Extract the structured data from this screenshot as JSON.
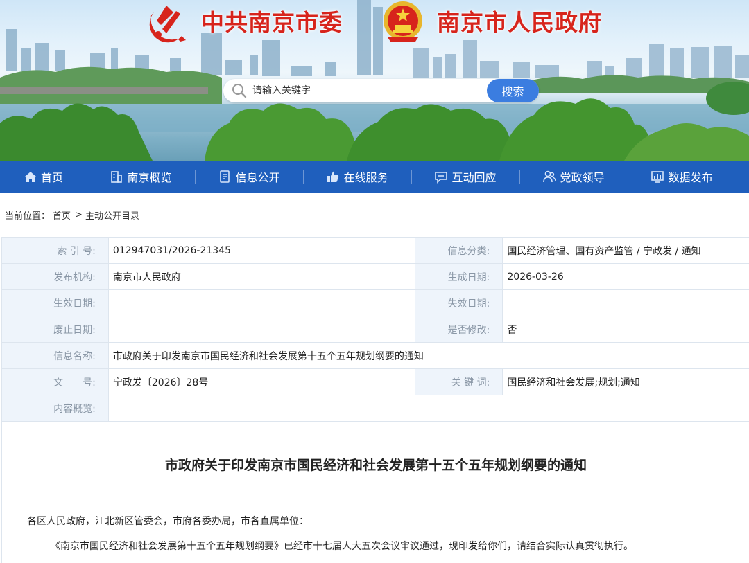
{
  "header": {
    "party_title": "中共南京市委",
    "gov_title": "南京市人民政府",
    "search": {
      "placeholder": "请输入关键字",
      "button": "搜索"
    }
  },
  "nav": {
    "items": [
      {
        "label": "首页",
        "icon": "home-icon"
      },
      {
        "label": "南京概览",
        "icon": "building-icon"
      },
      {
        "label": "信息公开",
        "icon": "document-icon"
      },
      {
        "label": "在线服务",
        "icon": "thumbs-up-icon"
      },
      {
        "label": "互动回应",
        "icon": "chat-icon"
      },
      {
        "label": "党政领导",
        "icon": "people-icon"
      },
      {
        "label": "数据发布",
        "icon": "chart-icon"
      }
    ]
  },
  "breadcrumb": {
    "prefix": "当前位置：",
    "home": "首页",
    "separator": ">",
    "current": "主动公开目录"
  },
  "meta": {
    "index_label": "索 引 号:",
    "index_value": "012947031/2026-21345",
    "category_label": "信息分类:",
    "category_value": "国民经济管理、国有资产监管 / 宁政发 / 通知",
    "publisher_label": "发布机构:",
    "publisher_value": "南京市人民政府",
    "created_label": "生成日期:",
    "created_value": "2026-03-26",
    "effective_label": "生效日期:",
    "effective_value": "",
    "expire_label": "失效日期:",
    "expire_value": "",
    "abolish_label": "废止日期:",
    "abolish_value": "",
    "modified_label": "是否修改:",
    "modified_value": "否",
    "name_label": "信息名称:",
    "name_value": "市政府关于印发南京市国民经济和社会发展第十五个五年规划纲要的通知",
    "docno_label": "文　　号:",
    "docno_value": "宁政发〔2026〕28号",
    "keywords_label": "关 键 词:",
    "keywords_value": "国民经济和社会发展;规划;通知",
    "summary_label": "内容概览:",
    "summary_value": ""
  },
  "content": {
    "title": "市政府关于印发南京市国民经济和社会发展第十五个五年规划纲要的通知",
    "salutation": "各区人民政府，江北新区管委会，市府各委办局，市各直属单位：",
    "body": "《南京市国民经济和社会发展第十五个五年规划纲要》已经市十七届人大五次会议审议通过，现印发给你们，请结合实际认真贯彻执行。"
  },
  "colors": {
    "nav_bg": "#1f5fbd",
    "search_button": "#3b7de0",
    "title_red": "#d7241c",
    "label_bg": "#eef4fb"
  }
}
